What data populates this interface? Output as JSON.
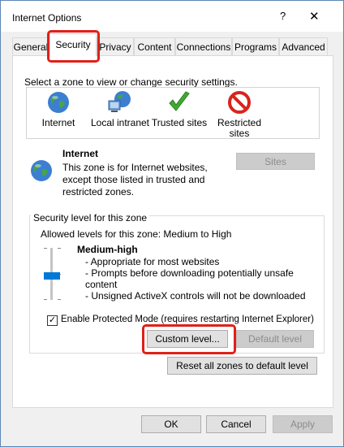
{
  "window": {
    "title": "Internet Options",
    "help_label": "?",
    "close_label": "✕"
  },
  "tabs": [
    {
      "label": "General"
    },
    {
      "label": "Security"
    },
    {
      "label": "Privacy"
    },
    {
      "label": "Content"
    },
    {
      "label": "Connections"
    },
    {
      "label": "Programs"
    },
    {
      "label": "Advanced"
    }
  ],
  "security": {
    "zone_prompt": "Select a zone to view or change security settings.",
    "zones": [
      {
        "label": "Internet",
        "icon": "globe-icon"
      },
      {
        "label": "Local intranet",
        "icon": "intranet-icon"
      },
      {
        "label": "Trusted sites",
        "icon": "checkmark-icon"
      },
      {
        "label": "Restricted sites",
        "icon": "prohibited-icon"
      }
    ],
    "selected_zone": {
      "name": "Internet",
      "description": "This zone is for Internet websites, except those listed in trusted and restricted zones."
    },
    "sites_button": "Sites",
    "level_group": {
      "title": "Security level for this zone",
      "allowed": "Allowed levels for this zone: Medium to High",
      "level_name": "Medium-high",
      "bullets": [
        "- Appropriate for most websites",
        "- Prompts before downloading potentially unsafe content",
        "- Unsigned ActiveX controls will not be downloaded"
      ],
      "protected_mode_label": "Enable Protected Mode (requires restarting Internet Explorer)",
      "protected_mode_checked": true,
      "custom_level_button": "Custom level...",
      "default_level_button": "Default level"
    },
    "reset_all_button": "Reset all zones to default level"
  },
  "footer": {
    "ok": "OK",
    "cancel": "Cancel",
    "apply": "Apply"
  },
  "colors": {
    "highlight": "#e0201a",
    "slider_thumb": "#0078d7"
  }
}
